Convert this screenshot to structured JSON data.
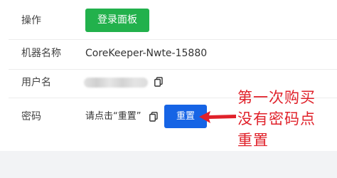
{
  "rows": [
    {
      "label": "操作",
      "button_label": "登录面板"
    },
    {
      "label": "机器名称",
      "value": "CoreKeeper-Nwte-15880"
    },
    {
      "label": "用户名"
    },
    {
      "label": "密码",
      "hint": "请点击“重置”",
      "button_label": "重置"
    }
  ],
  "annotation": {
    "line1": "第一次购买",
    "line2": "没有密码点",
    "line3": "重置"
  },
  "colors": {
    "green_button": "#22b14c",
    "blue_button": "#1664e5",
    "annotation": "#e0212a"
  },
  "icons": [
    "copy-icon",
    "arrow-icon"
  ]
}
